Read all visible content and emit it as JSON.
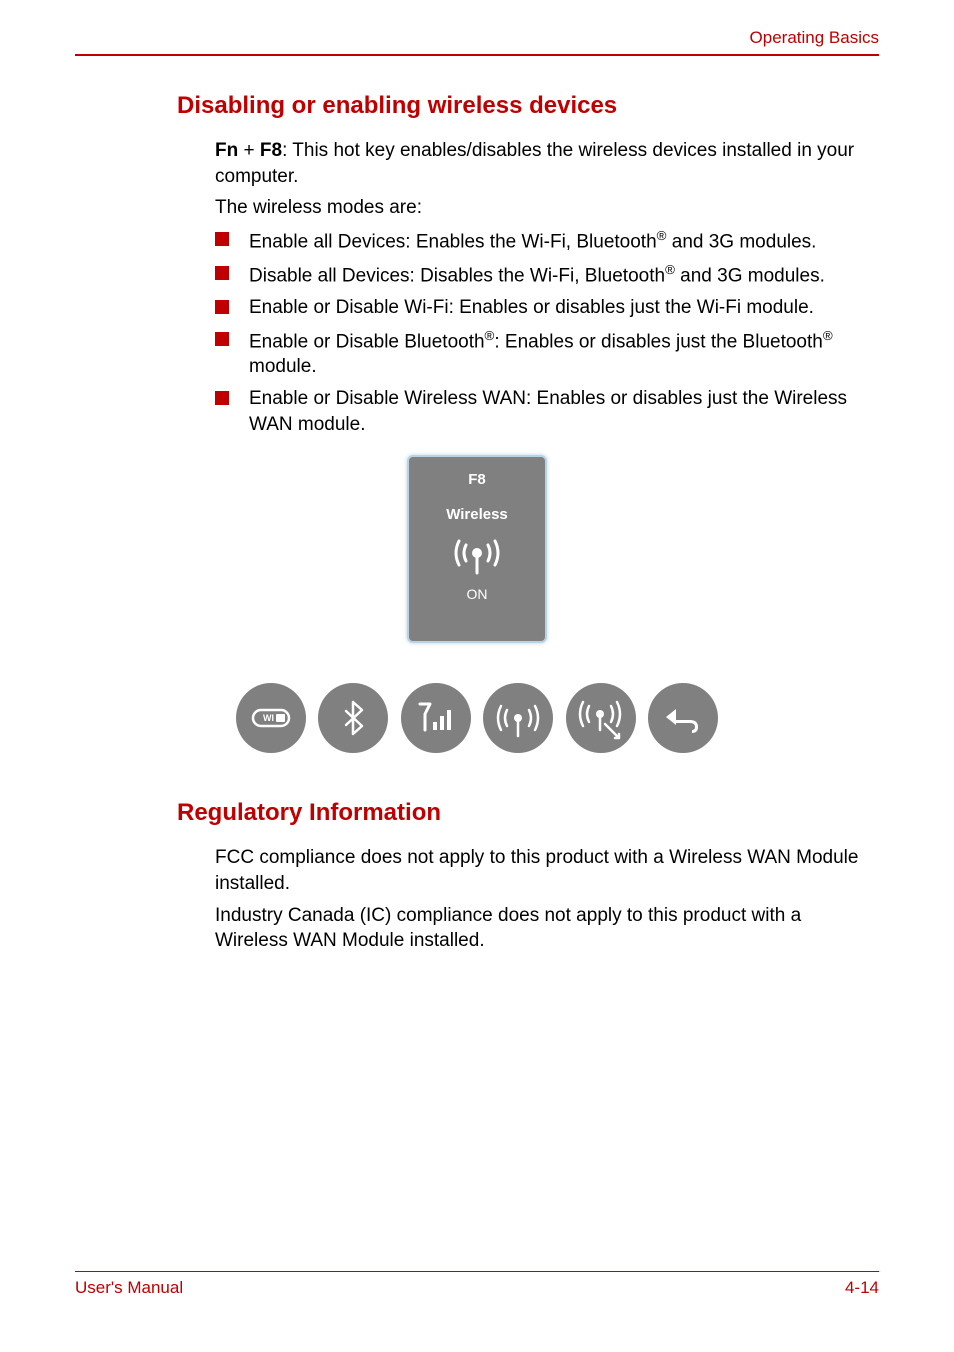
{
  "header": {
    "section": "Operating Basics"
  },
  "section1": {
    "heading": "Disabling or enabling wireless devices",
    "intro_prefix_bold1": "Fn",
    "intro_plus": " + ",
    "intro_prefix_bold2": "F8",
    "intro_rest": ": This hot key enables/disables the wireless devices installed in your computer.",
    "modes_intro": "The wireless modes are:",
    "bullets": {
      "b1_pre": "Enable all Devices: Enables the Wi-Fi, Bluetooth",
      "b1_sup": "®",
      "b1_post": " and 3G modules.",
      "b2_pre": "Disable all Devices: Disables the Wi-Fi, Bluetooth",
      "b2_sup": "®",
      "b2_post": " and 3G modules.",
      "b3": "Enable or Disable Wi-Fi: Enables or disables just the Wi-Fi module.",
      "b4_pre": "Enable or Disable Bluetooth",
      "b4_sup1": "®",
      "b4_mid": ": Enables or disables just the Bluetooth",
      "b4_sup2": "®",
      "b4_post": " module.",
      "b5": "Enable or Disable Wireless WAN: Enables or disables just the Wireless WAN module."
    }
  },
  "card": {
    "key": "F8",
    "label": "Wireless",
    "state": "ON"
  },
  "icons": {
    "wifi": "wifi-icon",
    "bluetooth": "bluetooth-icon",
    "signal": "signal-icon",
    "antenna": "antenna-icon",
    "antenna_arrow": "antenna-arrow-icon",
    "back": "back-icon"
  },
  "section2": {
    "heading": "Regulatory Information",
    "p1": "FCC compliance does not apply to this product with a Wireless WAN Module installed.",
    "p2": "Industry Canada (IC) compliance does not apply to this product with a Wireless WAN Module installed."
  },
  "footer": {
    "left": "User's Manual",
    "right": "4-14"
  }
}
